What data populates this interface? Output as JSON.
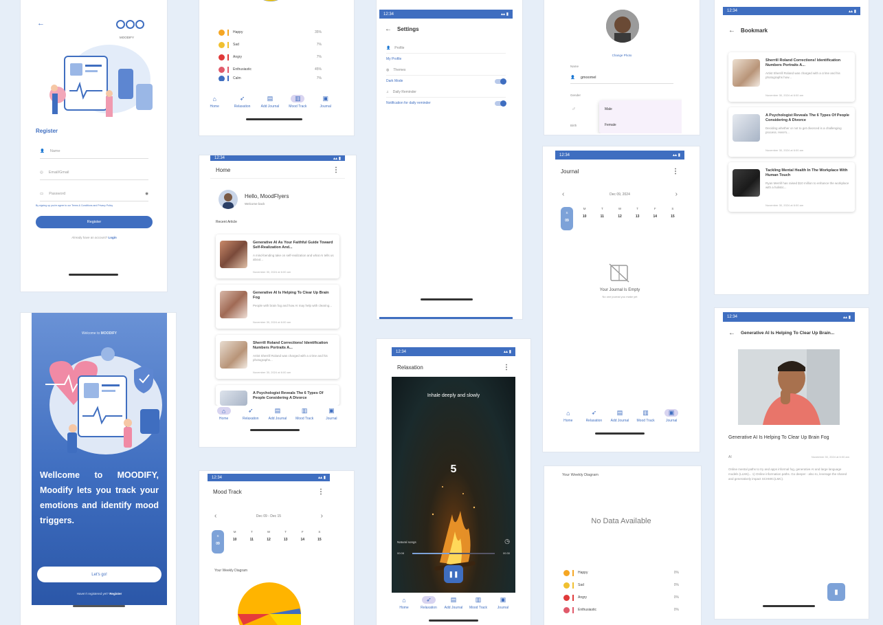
{
  "colors": {
    "primary": "#3f6ec0",
    "background": "#e6eef8",
    "accent": "#d8d4f0"
  },
  "status_time": "12:34",
  "nav": {
    "items": [
      {
        "label": "Home",
        "icon": "home-icon"
      },
      {
        "label": "Relaxation",
        "icon": "feather-icon"
      },
      {
        "label": "Add Journal",
        "icon": "add-journal-icon"
      },
      {
        "label": "Mood Track",
        "icon": "chart-icon"
      },
      {
        "label": "Journal",
        "icon": "book-icon"
      }
    ]
  },
  "register": {
    "title": "Register",
    "brand": "MOODIFY",
    "name_placeholder": "Name",
    "email_placeholder": "Email/Gmail",
    "password_placeholder": "Password",
    "terms": "By signing up you're agree to our Terms & Conditions and Privacy Policy",
    "button": "Register",
    "have_account": "Already have an account?",
    "login": "Login"
  },
  "welcome": {
    "top_text": "Welcome to",
    "brand": "MOODIFY",
    "headline": "Wellcome to MOODIFY, Moodify lets you track your emotions and identify mood triggers.",
    "button": "Let's go!",
    "footer_q": "Haven't registered yet?",
    "footer_link": "Register"
  },
  "mood_top": {
    "moods": [
      {
        "label": "Happy",
        "pct": "35%",
        "color": "#f5a623"
      },
      {
        "label": "Sad",
        "pct": "7%",
        "color": "#f0c030"
      },
      {
        "label": "Angry",
        "pct": "7%",
        "color": "#e03a3a"
      },
      {
        "label": "Enthusiastic",
        "pct": "45%",
        "color": "#e05a6a"
      },
      {
        "label": "Calm",
        "pct": "7%",
        "color": "#3f6ec0"
      }
    ]
  },
  "home": {
    "title": "Home",
    "greeting": "Hello, MoodFlyers",
    "subgreeting": "Welcome back",
    "recent": "Recent Article",
    "articles": [
      {
        "title": "Generative AI As Your Faithful Guide Toward Self-Realization And...",
        "desc": "A mind-bending take on self-realization and what AI tells us about...",
        "date": "November 30, 2024 at 6:00 am"
      },
      {
        "title": "Generative AI Is Helping To Clear Up Brain Fog",
        "desc": "People with brain fog and how AI may help with clearing...",
        "date": "November 30, 2024 at 6:00 am"
      },
      {
        "title": "Sherrill Roland Corrections! Identification Numbers Portraits A...",
        "desc": "Artist Sherrill Roland was charged with a crime and his photographs...",
        "date": "November 30, 2024 at 6:00 am"
      },
      {
        "title": "A Psychologist Reveals The 6 Types Of People Considering A Divorce",
        "desc": "",
        "date": ""
      }
    ]
  },
  "mood_bottom": {
    "title": "Mood Track",
    "range": "Dec 09 - Dec 15",
    "days": [
      {
        "d": "S",
        "n": "09"
      },
      {
        "d": "M",
        "n": "10"
      },
      {
        "d": "T",
        "n": "11"
      },
      {
        "d": "W",
        "n": "12"
      },
      {
        "d": "T",
        "n": "13"
      },
      {
        "d": "F",
        "n": "14"
      },
      {
        "d": "S",
        "n": "15"
      }
    ],
    "weekly": "Your Weekly Diagram"
  },
  "settings": {
    "title": "Settings",
    "rows": [
      "Profile",
      "My Profile",
      "Themes",
      "Dark Mode",
      "Daily Reminder",
      "Notification for daily reminder"
    ]
  },
  "relax": {
    "title": "Relaxation",
    "instruction": "Inhale deeply and slowly",
    "count": "5",
    "song": "Natural songs",
    "t_start": "00:08",
    "t_end": "00:30"
  },
  "profile": {
    "change_photo": "Change Photo",
    "name_label": "Name",
    "name_value": "gmoomel",
    "gender_label": "Gender",
    "options": [
      "Male",
      "Female"
    ],
    "birth_label": "Birth"
  },
  "journal": {
    "title": "Journal",
    "date": "Dec 09, 2024",
    "days": [
      {
        "d": "S",
        "n": "09"
      },
      {
        "d": "M",
        "n": "10"
      },
      {
        "d": "T",
        "n": "11"
      },
      {
        "d": "W",
        "n": "12"
      },
      {
        "d": "T",
        "n": "13"
      },
      {
        "d": "F",
        "n": "14"
      },
      {
        "d": "S",
        "n": "15"
      }
    ],
    "empty_title": "Your Journal Is Empty",
    "empty_sub": "No one journal you make yet"
  },
  "diagram": {
    "title": "Your Weekly Diagram",
    "empty": "No Data Available",
    "moods": [
      {
        "label": "Happy",
        "pct": "0%",
        "color": "#f5a623"
      },
      {
        "label": "Sad",
        "pct": "0%",
        "color": "#f0c030"
      },
      {
        "label": "Angry",
        "pct": "0%",
        "color": "#e03a3a"
      },
      {
        "label": "Enthusiastic",
        "pct": "0%",
        "color": "#e05a6a"
      }
    ]
  },
  "bookmark": {
    "title": "Bookmark",
    "items": [
      {
        "title": "Sherrill Roland Corrections! Identification Numbers Portraits A...",
        "desc": "Artist Sherrill Roland was charged with a crime and his photographs how...",
        "date": "November 30, 2024 at 6:00 am"
      },
      {
        "title": "A Psychologist Reveals The 6 Types Of People Considering A Divorce",
        "desc": "Deciding whether or not to get divorced is a challenging process. Here's...",
        "date": "November 30, 2024 at 6:00 am"
      },
      {
        "title": "Tackling Mental Health In The Workplace With Human Touch",
        "desc": "Ryan Merrill has raised $10 million to enhance the workplace with a holistic...",
        "date": "November 30, 2024 at 6:00 am"
      }
    ]
  },
  "detail": {
    "header": "Generative AI Is Helping To Clear Up Brain...",
    "title": "Generative AI Is Helping To Clear Up Brain Fog",
    "author": "AI",
    "date": "November 30, 2024 at 6:00 am",
    "body": "Online mental paths to try and apps informal fog, generative AI and large language models (LLMs)... 1) Online information paths. Go deeper - also to, leverage the shared and generatively impact SCHMIC(LMC)."
  }
}
